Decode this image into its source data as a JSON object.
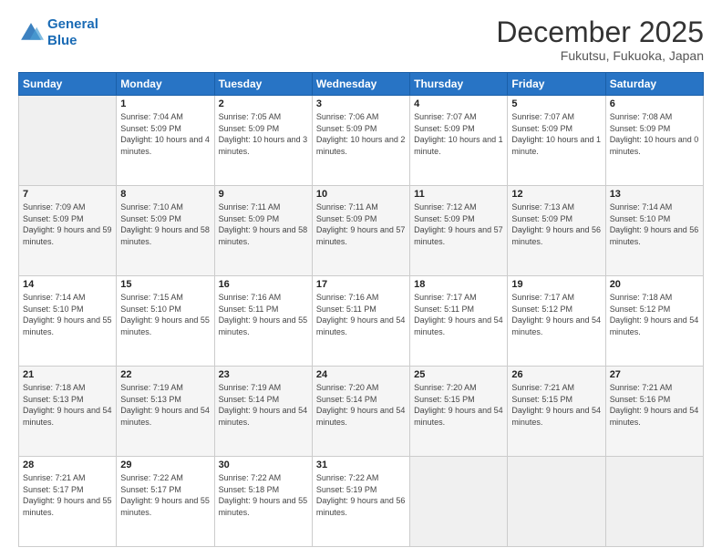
{
  "header": {
    "logo_line1": "General",
    "logo_line2": "Blue",
    "month_title": "December 2025",
    "location": "Fukutsu, Fukuoka, Japan"
  },
  "weekdays": [
    "Sunday",
    "Monday",
    "Tuesday",
    "Wednesday",
    "Thursday",
    "Friday",
    "Saturday"
  ],
  "weeks": [
    [
      {
        "day": "",
        "empty": true
      },
      {
        "day": "1",
        "sunrise": "7:04 AM",
        "sunset": "5:09 PM",
        "daylight": "10 hours and 4 minutes."
      },
      {
        "day": "2",
        "sunrise": "7:05 AM",
        "sunset": "5:09 PM",
        "daylight": "10 hours and 3 minutes."
      },
      {
        "day": "3",
        "sunrise": "7:06 AM",
        "sunset": "5:09 PM",
        "daylight": "10 hours and 2 minutes."
      },
      {
        "day": "4",
        "sunrise": "7:07 AM",
        "sunset": "5:09 PM",
        "daylight": "10 hours and 1 minute."
      },
      {
        "day": "5",
        "sunrise": "7:07 AM",
        "sunset": "5:09 PM",
        "daylight": "10 hours and 1 minute."
      },
      {
        "day": "6",
        "sunrise": "7:08 AM",
        "sunset": "5:09 PM",
        "daylight": "10 hours and 0 minutes."
      }
    ],
    [
      {
        "day": "7",
        "sunrise": "7:09 AM",
        "sunset": "5:09 PM",
        "daylight": "9 hours and 59 minutes."
      },
      {
        "day": "8",
        "sunrise": "7:10 AM",
        "sunset": "5:09 PM",
        "daylight": "9 hours and 58 minutes."
      },
      {
        "day": "9",
        "sunrise": "7:11 AM",
        "sunset": "5:09 PM",
        "daylight": "9 hours and 58 minutes."
      },
      {
        "day": "10",
        "sunrise": "7:11 AM",
        "sunset": "5:09 PM",
        "daylight": "9 hours and 57 minutes."
      },
      {
        "day": "11",
        "sunrise": "7:12 AM",
        "sunset": "5:09 PM",
        "daylight": "9 hours and 57 minutes."
      },
      {
        "day": "12",
        "sunrise": "7:13 AM",
        "sunset": "5:09 PM",
        "daylight": "9 hours and 56 minutes."
      },
      {
        "day": "13",
        "sunrise": "7:14 AM",
        "sunset": "5:10 PM",
        "daylight": "9 hours and 56 minutes."
      }
    ],
    [
      {
        "day": "14",
        "sunrise": "7:14 AM",
        "sunset": "5:10 PM",
        "daylight": "9 hours and 55 minutes."
      },
      {
        "day": "15",
        "sunrise": "7:15 AM",
        "sunset": "5:10 PM",
        "daylight": "9 hours and 55 minutes."
      },
      {
        "day": "16",
        "sunrise": "7:16 AM",
        "sunset": "5:11 PM",
        "daylight": "9 hours and 55 minutes."
      },
      {
        "day": "17",
        "sunrise": "7:16 AM",
        "sunset": "5:11 PM",
        "daylight": "9 hours and 54 minutes."
      },
      {
        "day": "18",
        "sunrise": "7:17 AM",
        "sunset": "5:11 PM",
        "daylight": "9 hours and 54 minutes."
      },
      {
        "day": "19",
        "sunrise": "7:17 AM",
        "sunset": "5:12 PM",
        "daylight": "9 hours and 54 minutes."
      },
      {
        "day": "20",
        "sunrise": "7:18 AM",
        "sunset": "5:12 PM",
        "daylight": "9 hours and 54 minutes."
      }
    ],
    [
      {
        "day": "21",
        "sunrise": "7:18 AM",
        "sunset": "5:13 PM",
        "daylight": "9 hours and 54 minutes."
      },
      {
        "day": "22",
        "sunrise": "7:19 AM",
        "sunset": "5:13 PM",
        "daylight": "9 hours and 54 minutes."
      },
      {
        "day": "23",
        "sunrise": "7:19 AM",
        "sunset": "5:14 PM",
        "daylight": "9 hours and 54 minutes."
      },
      {
        "day": "24",
        "sunrise": "7:20 AM",
        "sunset": "5:14 PM",
        "daylight": "9 hours and 54 minutes."
      },
      {
        "day": "25",
        "sunrise": "7:20 AM",
        "sunset": "5:15 PM",
        "daylight": "9 hours and 54 minutes."
      },
      {
        "day": "26",
        "sunrise": "7:21 AM",
        "sunset": "5:15 PM",
        "daylight": "9 hours and 54 minutes."
      },
      {
        "day": "27",
        "sunrise": "7:21 AM",
        "sunset": "5:16 PM",
        "daylight": "9 hours and 54 minutes."
      }
    ],
    [
      {
        "day": "28",
        "sunrise": "7:21 AM",
        "sunset": "5:17 PM",
        "daylight": "9 hours and 55 minutes."
      },
      {
        "day": "29",
        "sunrise": "7:22 AM",
        "sunset": "5:17 PM",
        "daylight": "9 hours and 55 minutes."
      },
      {
        "day": "30",
        "sunrise": "7:22 AM",
        "sunset": "5:18 PM",
        "daylight": "9 hours and 55 minutes."
      },
      {
        "day": "31",
        "sunrise": "7:22 AM",
        "sunset": "5:19 PM",
        "daylight": "9 hours and 56 minutes."
      },
      {
        "day": "",
        "empty": true
      },
      {
        "day": "",
        "empty": true
      },
      {
        "day": "",
        "empty": true
      }
    ]
  ]
}
